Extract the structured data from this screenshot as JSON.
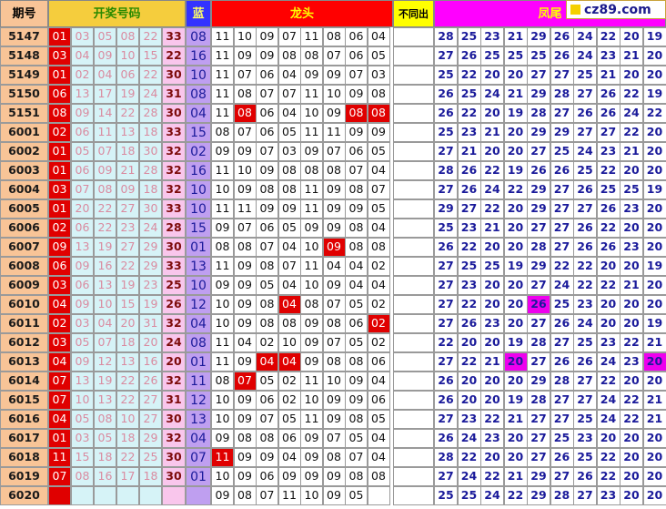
{
  "headers": {
    "period": "期号",
    "draw_numbers": "开奖号码",
    "blue": "蓝",
    "dragon_head": "龙头",
    "not_same_out": "不同出",
    "phoenix_tail": "凤尾"
  },
  "watermark": "cz89.com",
  "colors": {
    "period_bg": "#f8c497",
    "first_red_bg": "#e00000",
    "reds_bg": "#d6f3f7",
    "reds_text": "#d98ba0",
    "blue_bg": "#f9c6ec",
    "blue_text": "#7d0b0b",
    "blue2_bg": "#bf9ff0",
    "blue2_text": "#1a1a9a",
    "highlight_red": "#e00000",
    "highlight_magenta": "#ee00ee",
    "head_bg_red": "#ff0000",
    "head_bg_magenta": "#ff00ff",
    "head_bg_yellow": "#ffff00",
    "head_bg_gold": "#f5cd3d",
    "head_bg_blue": "#3333ff",
    "tail_text": "#1a1a9a"
  },
  "rows": [
    {
      "period": "5147",
      "reds": [
        "01",
        "03",
        "05",
        "08",
        "22"
      ],
      "blue": "33",
      "blue2": "08",
      "dragon": [
        "11",
        "10",
        "09",
        "07",
        "11",
        "08",
        "06",
        "04"
      ],
      "tail": [
        "28",
        "25",
        "23",
        "21",
        "29",
        "26",
        "24",
        "22",
        "20",
        "19"
      ]
    },
    {
      "period": "5148",
      "reds": [
        "03",
        "04",
        "09",
        "10",
        "15"
      ],
      "blue": "22",
      "blue2": "16",
      "dragon": [
        "11",
        "09",
        "09",
        "08",
        "08",
        "07",
        "06",
        "05"
      ],
      "tail": [
        "27",
        "26",
        "25",
        "25",
        "25",
        "26",
        "24",
        "23",
        "21",
        "20"
      ]
    },
    {
      "period": "5149",
      "reds": [
        "01",
        "02",
        "04",
        "06",
        "22"
      ],
      "blue": "30",
      "blue2": "10",
      "dragon": [
        "11",
        "07",
        "06",
        "04",
        "09",
        "09",
        "07",
        "03"
      ],
      "tail": [
        "25",
        "22",
        "20",
        "20",
        "27",
        "27",
        "25",
        "21",
        "20",
        "20"
      ]
    },
    {
      "period": "5150",
      "reds": [
        "06",
        "13",
        "17",
        "19",
        "24"
      ],
      "blue": "31",
      "blue2": "08",
      "dragon": [
        "11",
        "08",
        "07",
        "07",
        "11",
        "10",
        "09",
        "08"
      ],
      "tail": [
        "26",
        "25",
        "24",
        "21",
        "29",
        "28",
        "27",
        "26",
        "22",
        "19"
      ]
    },
    {
      "period": "5151",
      "reds": [
        "08",
        "09",
        "14",
        "22",
        "28"
      ],
      "blue": "30",
      "blue2": "04",
      "dragon": [
        "11",
        "08",
        "06",
        "04",
        "10",
        "09",
        "08",
        "08"
      ],
      "tail": [
        "26",
        "22",
        "20",
        "19",
        "28",
        "27",
        "26",
        "26",
        "24",
        "22"
      ]
    },
    {
      "period": "6001",
      "reds": [
        "02",
        "06",
        "11",
        "13",
        "18"
      ],
      "blue": "33",
      "blue2": "15",
      "dragon": [
        "08",
        "07",
        "06",
        "05",
        "11",
        "11",
        "09",
        "09"
      ],
      "tail": [
        "25",
        "23",
        "21",
        "20",
        "29",
        "29",
        "27",
        "27",
        "22",
        "20"
      ]
    },
    {
      "period": "6002",
      "reds": [
        "01",
        "05",
        "07",
        "18",
        "30"
      ],
      "blue": "32",
      "blue2": "02",
      "dragon": [
        "09",
        "09",
        "07",
        "03",
        "09",
        "07",
        "06",
        "05"
      ],
      "tail": [
        "27",
        "21",
        "20",
        "20",
        "27",
        "25",
        "24",
        "23",
        "21",
        "20"
      ]
    },
    {
      "period": "6003",
      "reds": [
        "01",
        "06",
        "09",
        "21",
        "28"
      ],
      "blue": "32",
      "blue2": "16",
      "dragon": [
        "11",
        "10",
        "09",
        "08",
        "08",
        "08",
        "07",
        "04"
      ],
      "tail": [
        "28",
        "26",
        "22",
        "19",
        "26",
        "26",
        "25",
        "22",
        "20",
        "20"
      ]
    },
    {
      "period": "6004",
      "reds": [
        "03",
        "07",
        "08",
        "09",
        "18"
      ],
      "blue": "32",
      "blue2": "10",
      "dragon": [
        "10",
        "09",
        "08",
        "08",
        "11",
        "09",
        "08",
        "07"
      ],
      "tail": [
        "27",
        "26",
        "24",
        "22",
        "29",
        "27",
        "26",
        "25",
        "25",
        "19"
      ]
    },
    {
      "period": "6005",
      "reds": [
        "01",
        "20",
        "22",
        "27",
        "30"
      ],
      "blue": "33",
      "blue2": "10",
      "dragon": [
        "11",
        "11",
        "09",
        "09",
        "11",
        "09",
        "09",
        "05"
      ],
      "tail": [
        "29",
        "27",
        "22",
        "20",
        "29",
        "27",
        "27",
        "26",
        "23",
        "20"
      ]
    },
    {
      "period": "6006",
      "reds": [
        "02",
        "06",
        "22",
        "23",
        "24"
      ],
      "blue": "28",
      "blue2": "15",
      "dragon": [
        "09",
        "07",
        "06",
        "05",
        "09",
        "09",
        "08",
        "04"
      ],
      "tail": [
        "25",
        "23",
        "21",
        "20",
        "27",
        "27",
        "26",
        "22",
        "20",
        "20"
      ]
    },
    {
      "period": "6007",
      "reds": [
        "09",
        "13",
        "19",
        "27",
        "29"
      ],
      "blue": "30",
      "blue2": "01",
      "dragon": [
        "08",
        "08",
        "07",
        "04",
        "10",
        "09",
        "08",
        "08"
      ],
      "tail": [
        "26",
        "22",
        "20",
        "20",
        "28",
        "27",
        "26",
        "26",
        "23",
        "20"
      ]
    },
    {
      "period": "6008",
      "reds": [
        "06",
        "09",
        "16",
        "22",
        "29"
      ],
      "blue": "33",
      "blue2": "13",
      "dragon": [
        "11",
        "09",
        "08",
        "07",
        "11",
        "04",
        "04",
        "02"
      ],
      "tail": [
        "27",
        "25",
        "25",
        "19",
        "29",
        "22",
        "22",
        "20",
        "20",
        "19"
      ]
    },
    {
      "period": "6009",
      "reds": [
        "03",
        "06",
        "13",
        "19",
        "23"
      ],
      "blue": "25",
      "blue2": "10",
      "dragon": [
        "09",
        "09",
        "05",
        "04",
        "10",
        "09",
        "04",
        "04"
      ],
      "tail": [
        "27",
        "23",
        "20",
        "20",
        "27",
        "24",
        "22",
        "22",
        "21",
        "20"
      ]
    },
    {
      "period": "6010",
      "reds": [
        "04",
        "09",
        "10",
        "15",
        "19"
      ],
      "blue": "26",
      "blue2": "12",
      "dragon": [
        "10",
        "09",
        "08",
        "04",
        "08",
        "07",
        "05",
        "02"
      ],
      "tail": [
        "27",
        "22",
        "20",
        "20",
        "26",
        "25",
        "23",
        "20",
        "20",
        "20"
      ]
    },
    {
      "period": "6011",
      "reds": [
        "02",
        "03",
        "04",
        "20",
        "31"
      ],
      "blue": "32",
      "blue2": "04",
      "dragon": [
        "10",
        "09",
        "08",
        "08",
        "09",
        "08",
        "06",
        "02"
      ],
      "tail": [
        "27",
        "26",
        "23",
        "20",
        "27",
        "26",
        "24",
        "20",
        "20",
        "19"
      ]
    },
    {
      "period": "6012",
      "reds": [
        "03",
        "05",
        "07",
        "18",
        "20"
      ],
      "blue": "24",
      "blue2": "08",
      "dragon": [
        "11",
        "04",
        "02",
        "10",
        "09",
        "07",
        "05",
        "02"
      ],
      "tail": [
        "22",
        "20",
        "20",
        "19",
        "28",
        "27",
        "25",
        "23",
        "22",
        "21"
      ]
    },
    {
      "period": "6013",
      "reds": [
        "04",
        "09",
        "12",
        "13",
        "16"
      ],
      "blue": "20",
      "blue2": "01",
      "dragon": [
        "11",
        "09",
        "04",
        "04",
        "09",
        "08",
        "08",
        "06"
      ],
      "tail": [
        "27",
        "22",
        "21",
        "20",
        "27",
        "26",
        "26",
        "24",
        "23",
        "20"
      ]
    },
    {
      "period": "6014",
      "reds": [
        "07",
        "13",
        "19",
        "22",
        "26"
      ],
      "blue": "32",
      "blue2": "11",
      "dragon": [
        "08",
        "07",
        "05",
        "02",
        "11",
        "10",
        "09",
        "04"
      ],
      "tail": [
        "26",
        "20",
        "20",
        "20",
        "29",
        "28",
        "27",
        "22",
        "20",
        "20"
      ]
    },
    {
      "period": "6015",
      "reds": [
        "07",
        "10",
        "13",
        "22",
        "27"
      ],
      "blue": "31",
      "blue2": "12",
      "dragon": [
        "10",
        "09",
        "06",
        "02",
        "10",
        "09",
        "09",
        "06"
      ],
      "tail": [
        "26",
        "20",
        "20",
        "19",
        "28",
        "27",
        "27",
        "24",
        "22",
        "21"
      ]
    },
    {
      "period": "6016",
      "reds": [
        "04",
        "05",
        "08",
        "10",
        "27"
      ],
      "blue": "30",
      "blue2": "13",
      "dragon": [
        "10",
        "09",
        "07",
        "05",
        "11",
        "09",
        "08",
        "05"
      ],
      "tail": [
        "27",
        "23",
        "22",
        "21",
        "27",
        "27",
        "25",
        "24",
        "22",
        "21"
      ]
    },
    {
      "period": "6017",
      "reds": [
        "01",
        "03",
        "05",
        "18",
        "29"
      ],
      "blue": "32",
      "blue2": "04",
      "dragon": [
        "09",
        "08",
        "08",
        "06",
        "09",
        "07",
        "05",
        "04"
      ],
      "tail": [
        "26",
        "24",
        "23",
        "20",
        "27",
        "25",
        "23",
        "20",
        "20",
        "20"
      ]
    },
    {
      "period": "6018",
      "reds": [
        "11",
        "15",
        "18",
        "22",
        "25"
      ],
      "blue": "30",
      "blue2": "07",
      "dragon": [
        "11",
        "09",
        "09",
        "04",
        "09",
        "08",
        "07",
        "04"
      ],
      "tail": [
        "28",
        "22",
        "20",
        "20",
        "27",
        "26",
        "25",
        "22",
        "20",
        "20"
      ]
    },
    {
      "period": "6019",
      "reds": [
        "07",
        "08",
        "16",
        "17",
        "18"
      ],
      "blue": "30",
      "blue2": "01",
      "dragon": [
        "10",
        "09",
        "06",
        "09",
        "09",
        "09",
        "08",
        "08"
      ],
      "tail": [
        "27",
        "24",
        "22",
        "21",
        "29",
        "27",
        "26",
        "22",
        "20",
        "20"
      ]
    },
    {
      "period": "6020",
      "reds": [
        "",
        "",
        "",
        "",
        ""
      ],
      "blue": "",
      "blue2": "",
      "dragon": [
        "09",
        "08",
        "07",
        "11",
        "10",
        "09",
        "05",
        ""
      ],
      "tail": [
        "25",
        "25",
        "24",
        "22",
        "29",
        "28",
        "27",
        "23",
        "20",
        "20"
      ]
    }
  ],
  "highlights": {
    "dragon_red": [
      [
        4,
        1
      ],
      [
        4,
        6
      ],
      [
        4,
        7
      ],
      [
        11,
        5
      ],
      [
        14,
        3
      ],
      [
        15,
        7
      ],
      [
        17,
        2
      ],
      [
        17,
        3
      ],
      [
        18,
        1
      ],
      [
        22,
        0
      ]
    ],
    "tail_magenta": [
      [
        14,
        4
      ],
      [
        17,
        3
      ],
      [
        17,
        9
      ]
    ]
  }
}
